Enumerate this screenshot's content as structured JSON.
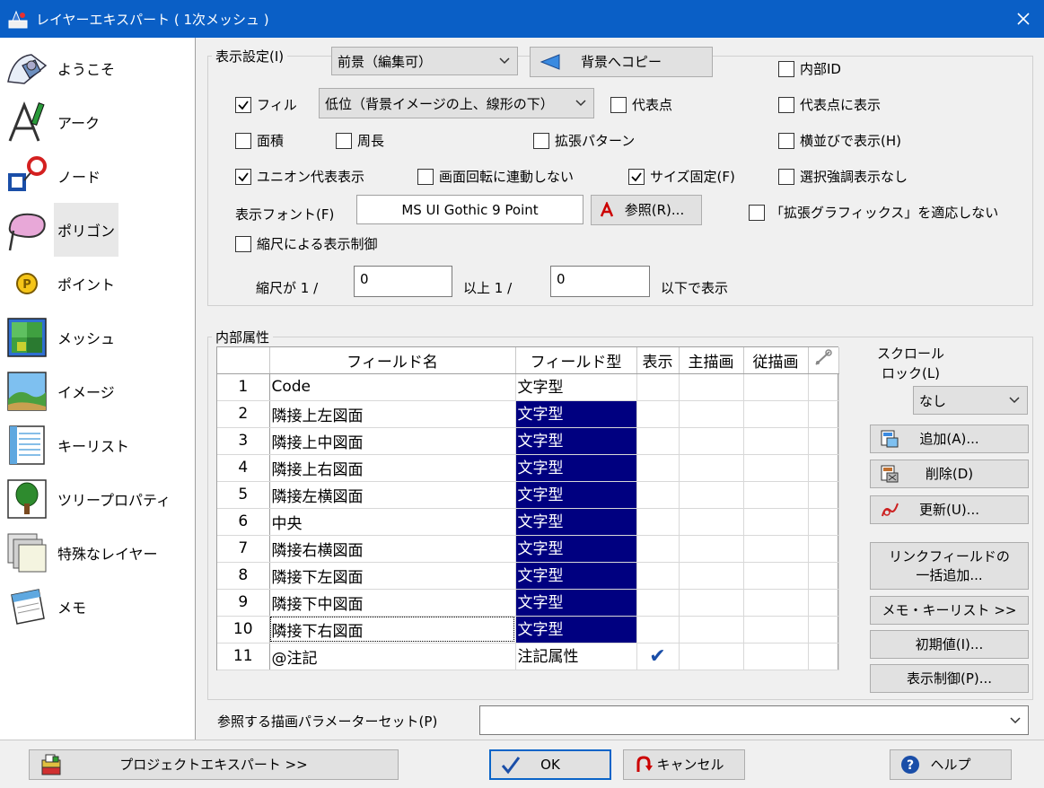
{
  "window": {
    "title": "レイヤーエキスパート ( 1次メッシュ )",
    "close_glyph": "✕"
  },
  "nav": [
    {
      "label": "ようこそ",
      "icon": "welcome-icon"
    },
    {
      "label": "アーク",
      "icon": "arc-icon"
    },
    {
      "label": "ノード",
      "icon": "node-icon"
    },
    {
      "label": "ポリゴン",
      "icon": "polygon-icon"
    },
    {
      "label": "ポイント",
      "icon": "point-icon"
    },
    {
      "label": "メッシュ",
      "icon": "mesh-icon"
    },
    {
      "label": "イメージ",
      "icon": "image-icon"
    },
    {
      "label": "キーリスト",
      "icon": "keylist-icon"
    },
    {
      "label": "ツリープロパティ",
      "icon": "tree-property-icon"
    },
    {
      "label": "特殊なレイヤー",
      "icon": "special-layer-icon"
    },
    {
      "label": "メモ",
      "icon": "memo-icon"
    }
  ],
  "display": {
    "group_title": "表示設定(I)",
    "foreground_select": "前景（編集可）",
    "copy_button": "背景へコピー",
    "internal_id": "内部ID",
    "fill": "フィル",
    "fill_position_select": "低位（背景イメージの上、線形の下）",
    "representative_point": "代表点",
    "show_on_rep_point": "代表点に表示",
    "area": "面積",
    "perimeter": "周長",
    "extended_pattern": "拡張パターン",
    "horizontal_display": "横並びで表示(H)",
    "union_rep_display": "ユニオン代表表示",
    "no_rotation_link": "画面回転に連動しない",
    "fixed_size": "サイズ固定(F)",
    "no_select_highlight": "選択強調表示なし",
    "font_label": "表示フォント(F)",
    "font_value": "MS UI Gothic 9 Point",
    "browse_button": "参照(R)...",
    "no_ext_graphics": "「拡張グラフィックス」を適応しない",
    "scale_control": "縮尺による表示制御",
    "scale_prefix": "縮尺が 1 /",
    "scale_min": "0",
    "scale_mid": "以上 1 /",
    "scale_max": "0",
    "scale_suffix": "以下で表示"
  },
  "attributes": {
    "group_title": "内部属性",
    "columns": [
      "フィールド名",
      "フィールド型",
      "表示",
      "主描画",
      "従描画"
    ],
    "rows": [
      {
        "n": "1",
        "name": "Code",
        "type": "文字型",
        "hl": false,
        "shown": ""
      },
      {
        "n": "2",
        "name": "隣接上左図面",
        "type": "文字型",
        "hl": true,
        "shown": ""
      },
      {
        "n": "3",
        "name": "隣接上中図面",
        "type": "文字型",
        "hl": true,
        "shown": ""
      },
      {
        "n": "4",
        "name": "隣接上右図面",
        "type": "文字型",
        "hl": true,
        "shown": ""
      },
      {
        "n": "5",
        "name": "隣接左横図面",
        "type": "文字型",
        "hl": true,
        "shown": ""
      },
      {
        "n": "6",
        "name": "中央",
        "type": "文字型",
        "hl": true,
        "shown": ""
      },
      {
        "n": "7",
        "name": "隣接右横図面",
        "type": "文字型",
        "hl": true,
        "shown": ""
      },
      {
        "n": "8",
        "name": "隣接下左図面",
        "type": "文字型",
        "hl": true,
        "shown": ""
      },
      {
        "n": "9",
        "name": "隣接下中図面",
        "type": "文字型",
        "hl": true,
        "shown": ""
      },
      {
        "n": "10",
        "name": "隣接下右図面",
        "type": "文字型",
        "hl": true,
        "shown": ""
      },
      {
        "n": "11",
        "name": "@注記",
        "type": "注記属性",
        "hl": false,
        "shown": "✔"
      }
    ],
    "scroll_lock_label": "スクロール\nロック(L)",
    "scroll_lock_value": "なし",
    "add_button": "追加(A)...",
    "delete_button": "削除(D)",
    "update_button": "更新(U)...",
    "link_field_button": "リンクフィールドの\n一括追加...",
    "memo_keylist_button": "メモ・キーリスト >>",
    "initial_value_button": "初期値(I)...",
    "display_control_button": "表示制御(P)..."
  },
  "param_set": {
    "label": "参照する描画パラメーターセット(P)",
    "value": ""
  },
  "footer": {
    "project_expert": "プロジェクトエキスパート >>",
    "ok": "OK",
    "cancel": "キャンセル",
    "help": "ヘルプ"
  },
  "colors": {
    "titlebar": "#0a5fc6",
    "selection": "#000080",
    "accent_red": "#cc0000"
  }
}
